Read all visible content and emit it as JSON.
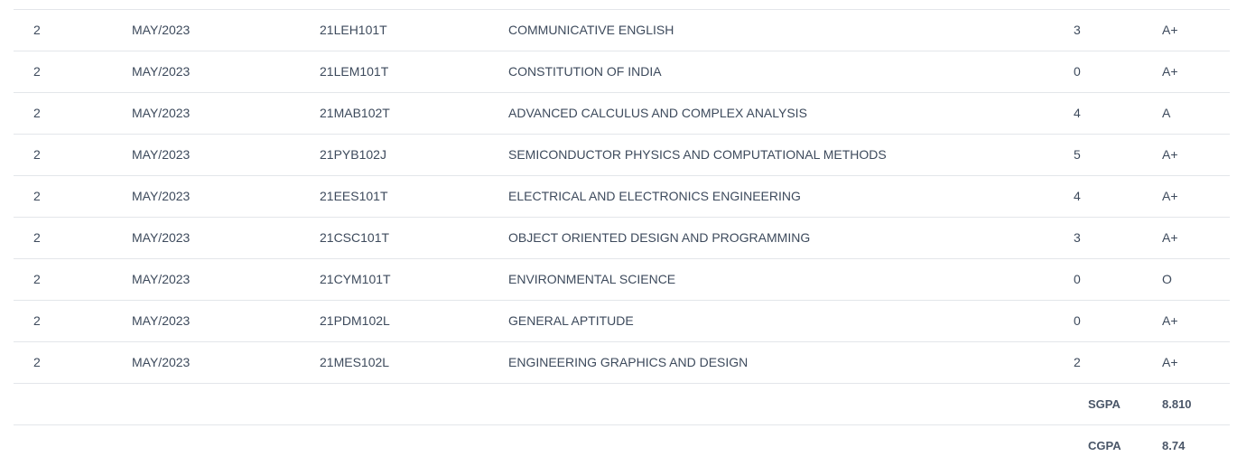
{
  "results": {
    "rows": [
      {
        "semester": "2",
        "month_year": "MAY/2023",
        "course_code": "21LEH101T",
        "course_title": "COMMUNICATIVE ENGLISH",
        "credit": "3",
        "grade": "A+"
      },
      {
        "semester": "2",
        "month_year": "MAY/2023",
        "course_code": "21LEM101T",
        "course_title": "CONSTITUTION OF INDIA",
        "credit": "0",
        "grade": "A+"
      },
      {
        "semester": "2",
        "month_year": "MAY/2023",
        "course_code": "21MAB102T",
        "course_title": "ADVANCED CALCULUS AND COMPLEX ANALYSIS",
        "credit": "4",
        "grade": "A"
      },
      {
        "semester": "2",
        "month_year": "MAY/2023",
        "course_code": "21PYB102J",
        "course_title": "SEMICONDUCTOR PHYSICS AND COMPUTATIONAL METHODS",
        "credit": "5",
        "grade": "A+"
      },
      {
        "semester": "2",
        "month_year": "MAY/2023",
        "course_code": "21EES101T",
        "course_title": "ELECTRICAL AND ELECTRONICS ENGINEERING",
        "credit": "4",
        "grade": "A+"
      },
      {
        "semester": "2",
        "month_year": "MAY/2023",
        "course_code": "21CSC101T",
        "course_title": "OBJECT ORIENTED DESIGN AND PROGRAMMING",
        "credit": "3",
        "grade": "A+"
      },
      {
        "semester": "2",
        "month_year": "MAY/2023",
        "course_code": "21CYM101T",
        "course_title": "ENVIRONMENTAL SCIENCE",
        "credit": "0",
        "grade": "O"
      },
      {
        "semester": "2",
        "month_year": "MAY/2023",
        "course_code": "21PDM102L",
        "course_title": "GENERAL APTITUDE",
        "credit": "0",
        "grade": "A+"
      },
      {
        "semester": "2",
        "month_year": "MAY/2023",
        "course_code": "21MES102L",
        "course_title": "ENGINEERING GRAPHICS AND DESIGN",
        "credit": "2",
        "grade": "A+"
      }
    ],
    "summary": {
      "sgpa_label": "SGPA",
      "sgpa_value": "8.810",
      "cgpa_label": "CGPA",
      "cgpa_value": "8.74"
    }
  }
}
